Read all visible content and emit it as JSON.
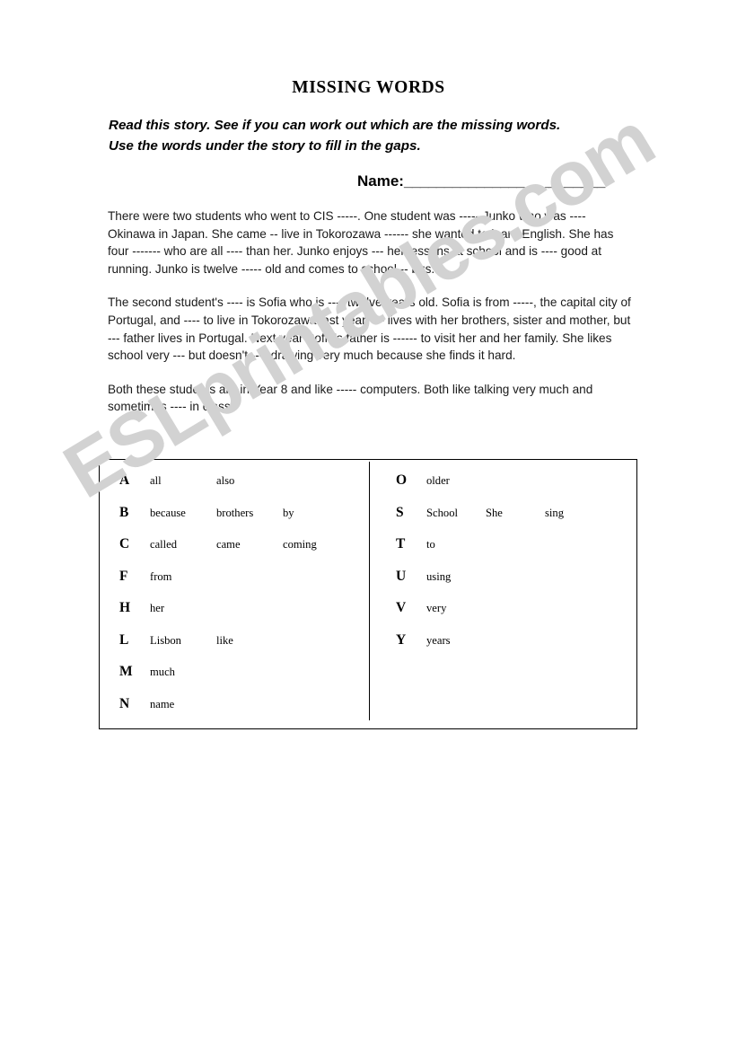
{
  "document": {
    "title": "MISSING WORDS",
    "instructions": [
      "Read this story. See if you can work out which are the missing words.",
      "Use the words under the story to fill in the gaps."
    ],
    "name_field": {
      "label": "Name:",
      "rule": "_________________________"
    },
    "story": {
      "paragraphs": [
        "There were two students who went to CIS -----. One student was ----- Junko who was ---- Okinawa in Japan. She came -- live in Tokorozawa ------ she wanted to learn English. She has four ------- who are all ---- than her. Junko enjoys --- her lessons at school and is ---- good at running. Junko is twelve ----- old and comes to school -- bus.",
        "The second student's ---- is Sofia who is ---- twelve years old. Sofia is from -----, the capital city of Portugal, and ---- to live in Tokorozawa last year. --- lives with her brothers, sister and mother, but --- father lives in Portugal. Next year Sofia's father is ------ to visit her and her family. She likes school very --- but doesn't ---- drawing very much because she finds it hard.",
        "Both these students are in Year 8 and like ----- computers. Both like talking very much and sometimes ---- in class."
      ]
    },
    "word_bank": {
      "left_column": [
        {
          "letter": "A",
          "words": [
            "all",
            "also"
          ]
        },
        {
          "letter": "B",
          "words": [
            "because",
            "brothers",
            "by"
          ]
        },
        {
          "letter": "C",
          "words": [
            "called",
            "came",
            "coming"
          ]
        },
        {
          "letter": "F",
          "words": [
            "from"
          ]
        },
        {
          "letter": "H",
          "words": [
            "her"
          ]
        },
        {
          "letter": "L",
          "words": [
            "Lisbon",
            "like"
          ]
        },
        {
          "letter": "M",
          "words": [
            "much"
          ]
        },
        {
          "letter": "N",
          "words": [
            "name"
          ]
        }
      ],
      "right_column": [
        {
          "letter": "O",
          "words": [
            "older"
          ]
        },
        {
          "letter": "S",
          "words": [
            "School",
            "She",
            "sing"
          ]
        },
        {
          "letter": "T",
          "words": [
            "to"
          ]
        },
        {
          "letter": "U",
          "words": [
            "using"
          ]
        },
        {
          "letter": "V",
          "words": [
            "very"
          ]
        },
        {
          "letter": "Y",
          "words": [
            "years"
          ]
        }
      ]
    },
    "watermark": {
      "text": "ESLprintables.com",
      "color": "#d2d2d2"
    }
  }
}
